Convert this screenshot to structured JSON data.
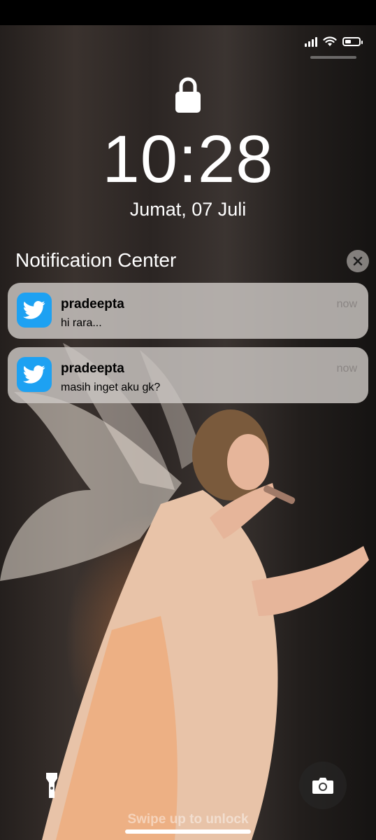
{
  "lockscreen": {
    "time": "10:28",
    "date": "Jumat, 07 Juli",
    "swipe_hint": "Swipe up to unlock"
  },
  "notification_center": {
    "title": "Notification Center",
    "notifications": [
      {
        "app": "twitter",
        "sender": "pradeepta",
        "message": "hi rara...",
        "time": "now"
      },
      {
        "app": "twitter",
        "sender": "pradeepta",
        "message": "masih inget aku gk?",
        "time": "now"
      }
    ]
  },
  "status_bar": {
    "icons": [
      "signal-icon",
      "wifi-icon",
      "battery-icon"
    ],
    "battery_level": 0.4
  },
  "quick_actions": [
    "flashlight-icon",
    "camera-icon"
  ],
  "colors": {
    "twitter_blue": "#1da1f2",
    "notification_bg": "#cdc8c5",
    "time_text": "#8a8583"
  }
}
